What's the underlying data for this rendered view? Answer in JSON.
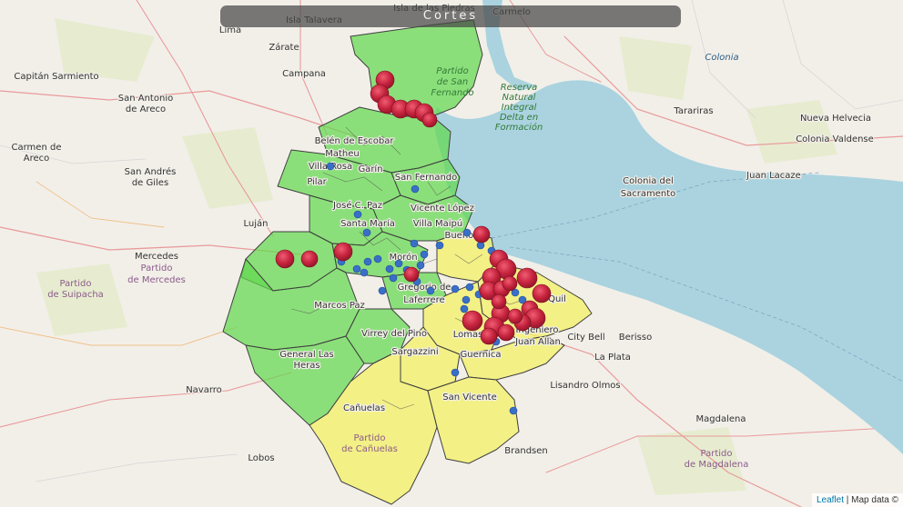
{
  "title": "Cortes",
  "attribution": {
    "leaflet": "Leaflet",
    "separator": " | ",
    "data": "Map data ©"
  },
  "colors": {
    "land": "#f2efe9",
    "water": "#aad3df",
    "zone_green": "#62d84f",
    "zone_yellow": "#f3ef6a",
    "marker_red": "#c7243e",
    "marker_blue": "#3a6fc7"
  },
  "places": [
    {
      "label": "Isla Talavera",
      "style": "normal"
    },
    {
      "label": "Isla de las Piedras",
      "style": "normal"
    },
    {
      "label": "Carmelo",
      "style": "normal"
    },
    {
      "label": "Lima",
      "style": "normal"
    },
    {
      "label": "Zárate",
      "style": "normal"
    },
    {
      "label": "Campana",
      "style": "normal"
    },
    {
      "label": "Colonia",
      "style": "water"
    },
    {
      "label": "Capitán Sarmiento",
      "style": "normal"
    },
    {
      "label": "San Antonio",
      "style": "normal"
    },
    {
      "label": "de Areco",
      "style": "normal"
    },
    {
      "label": "Partido",
      "style": "green"
    },
    {
      "label": "de San",
      "style": "green"
    },
    {
      "label": "Fernando",
      "style": "green"
    },
    {
      "label": "Reserva",
      "style": "green"
    },
    {
      "label": "Natural",
      "style": "green"
    },
    {
      "label": "Integral",
      "style": "green"
    },
    {
      "label": "Delta en",
      "style": "green"
    },
    {
      "label": "Formación",
      "style": "green"
    },
    {
      "label": "Tarariras",
      "style": "normal"
    },
    {
      "label": "Nueva Helvecia",
      "style": "normal"
    },
    {
      "label": "Colonia Valdense",
      "style": "normal"
    },
    {
      "label": "Carmen de",
      "style": "normal"
    },
    {
      "label": "Areco",
      "style": "normal"
    },
    {
      "label": "Belén de Escobar",
      "style": "normal"
    },
    {
      "label": "Matheu",
      "style": "normal"
    },
    {
      "label": "Villa Rosa",
      "style": "normal"
    },
    {
      "label": "Garín",
      "style": "normal"
    },
    {
      "label": "Pilar",
      "style": "normal"
    },
    {
      "label": "San Andrés",
      "style": "normal"
    },
    {
      "label": "de Giles",
      "style": "normal"
    },
    {
      "label": "San Fernando",
      "style": "normal"
    },
    {
      "label": "Colonia del",
      "style": "normal"
    },
    {
      "label": "Sacramento",
      "style": "normal"
    },
    {
      "label": "Juan Lacaze",
      "style": "normal"
    },
    {
      "label": "José C. Paz",
      "style": "normal"
    },
    {
      "label": "Vicente López",
      "style": "normal"
    },
    {
      "label": "Luján",
      "style": "normal"
    },
    {
      "label": "Santa María",
      "style": "normal"
    },
    {
      "label": "Villa Maipú",
      "style": "normal"
    },
    {
      "label": "Buenos",
      "style": "normal"
    },
    {
      "label": "Mercedes",
      "style": "normal"
    },
    {
      "label": "Partido",
      "style": "district"
    },
    {
      "label": "de Mercedes",
      "style": "district"
    },
    {
      "label": "Morón",
      "style": "normal"
    },
    {
      "label": "Partido",
      "style": "district"
    },
    {
      "label": "de Suipacha",
      "style": "district"
    },
    {
      "label": "Gregorio de",
      "style": "normal"
    },
    {
      "label": "Laferrere",
      "style": "normal"
    },
    {
      "label": "Marcos Paz",
      "style": "normal"
    },
    {
      "label": "Virrey del Pino",
      "style": "normal"
    },
    {
      "label": "Lomas",
      "style": "normal"
    },
    {
      "label": "Ingeniero",
      "style": "normal"
    },
    {
      "label": "Juan Allan",
      "style": "normal"
    },
    {
      "label": "City Bell",
      "style": "normal"
    },
    {
      "label": "Berisso",
      "style": "normal"
    },
    {
      "label": "General Las",
      "style": "normal"
    },
    {
      "label": "Heras",
      "style": "normal"
    },
    {
      "label": "Sargazzini",
      "style": "normal"
    },
    {
      "label": "Guernica",
      "style": "normal"
    },
    {
      "label": "La Plata",
      "style": "normal"
    },
    {
      "label": "Navarro",
      "style": "normal"
    },
    {
      "label": "Lisandro Olmos",
      "style": "normal"
    },
    {
      "label": "San Vicente",
      "style": "normal"
    },
    {
      "label": "Cañuelas",
      "style": "normal"
    },
    {
      "label": "Magdalena",
      "style": "normal"
    },
    {
      "label": "Partido",
      "style": "district"
    },
    {
      "label": "de Cañuelas",
      "style": "district"
    },
    {
      "label": "Lobos",
      "style": "normal"
    },
    {
      "label": "Brandsen",
      "style": "normal"
    },
    {
      "label": "Partido",
      "style": "district"
    },
    {
      "label": "de Magdalena",
      "style": "district"
    },
    {
      "label": "Quil",
      "style": "normal"
    }
  ]
}
